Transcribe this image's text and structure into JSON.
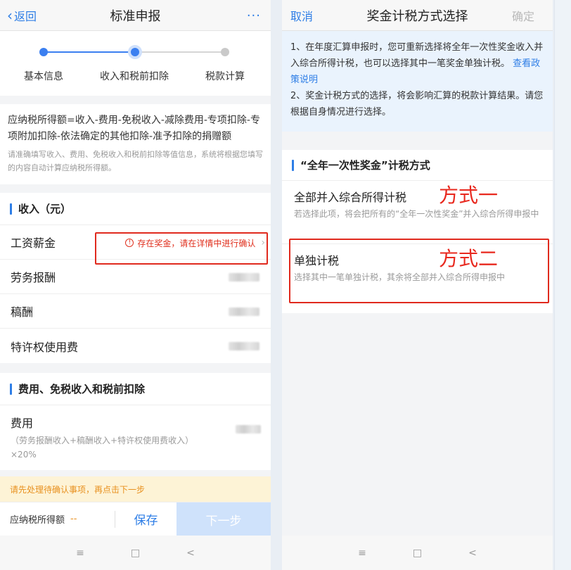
{
  "left": {
    "nav": {
      "back_label": "返回",
      "title": "标准申报",
      "more_label": "···"
    },
    "stepper": {
      "steps": [
        "基本信息",
        "收入和税前扣除",
        "税款计算"
      ],
      "current_step": 2
    },
    "formula": {
      "main": "应纳税所得额=收入-费用-免税收入-减除费用-专项扣除-专项附加扣除-依法确定的其他扣除-准予扣除的捐赠额",
      "hint": "请准确填写收入、费用、免税收入和税前扣除等值信息，系统将根据您填写的内容自动计算应纳税所得额。"
    },
    "income": {
      "title": "收入（元）",
      "rows": [
        {
          "label": "工资薪金",
          "warning": "存在奖金，请在详情中进行确认"
        },
        {
          "label": "劳务报酬"
        },
        {
          "label": "稿酬"
        },
        {
          "label": "特许权使用费"
        }
      ]
    },
    "deduction": {
      "title": "费用、免税收入和税前扣除",
      "fee_title": "费用",
      "fee_sub": "（劳务报酬收入+稿酬收入+特许权使用费收入）×20%"
    },
    "notice": "请先处理待确认事项，再点击下一步",
    "bottom": {
      "taxable_label": "应纳税所得额",
      "taxable_value": "--",
      "save_label": "保存",
      "next_label": "下一步"
    }
  },
  "right": {
    "nav": {
      "cancel_label": "取消",
      "title": "奖金计税方式选择",
      "confirm_label": "确定"
    },
    "info": {
      "line1": "1、在年度汇算申报时，您可重新选择将全年一次性奖金收入并入综合所得计税，也可以选择其中一笔奖金单独计税。",
      "link": "查看政策说明",
      "line2": "2、奖金计税方式的选择，将会影响汇算的税款计算结果。请您根据自身情况进行选择。"
    },
    "section_title": "“全年一次性奖金”计税方式",
    "options": [
      {
        "title": "全部并入综合所得计税",
        "desc": "若选择此项，将会把所有的“全年一次性奖金”并入综合所得申报中",
        "tag": "方式一"
      },
      {
        "title": "单独计税",
        "desc": "选择其中一笔单独计税，其余将全部并入综合所得申报中",
        "tag": "方式二"
      }
    ]
  },
  "system_nav": {
    "menu_icon": "≡",
    "home_icon": "□",
    "back_icon": "<"
  },
  "colors": {
    "accent": "#2e7ee6",
    "warning": "#e0301e",
    "annotation": "#e8281e",
    "notice_bg": "#fdf3d6",
    "info_bg": "#eaf3fd"
  }
}
